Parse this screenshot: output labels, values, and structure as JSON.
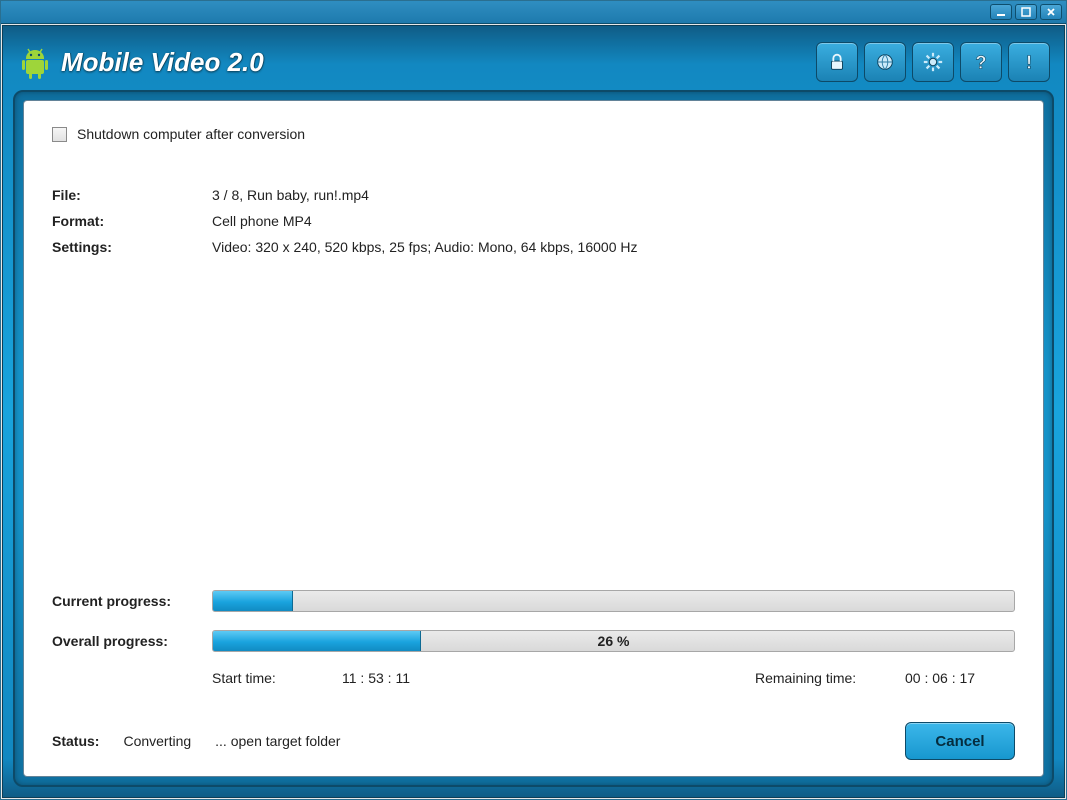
{
  "window_controls": {
    "minimize": "minimize",
    "maximize": "maximize",
    "close": "close"
  },
  "brand": {
    "title": "Mobile Video 2.0"
  },
  "header_icons": {
    "lock": "lock-icon",
    "globe": "globe-icon",
    "settings": "gear-icon",
    "help": "question-icon",
    "about": "exclaim-icon"
  },
  "options": {
    "shutdown_label": "Shutdown computer after conversion",
    "shutdown_checked": false
  },
  "info": {
    "file_label": "File:",
    "file_value": "3 / 8, Run baby, run!.mp4",
    "format_label": "Format:",
    "format_value": "Cell phone MP4",
    "settings_label": "Settings:",
    "settings_value": "Video: 320 x 240, 520 kbps, 25 fps; Audio: Mono, 64 kbps, 16000 Hz"
  },
  "progress": {
    "current_label": "Current progress:",
    "current_percent": 10,
    "overall_label": "Overall progress:",
    "overall_percent": 26,
    "overall_text": "26 %",
    "start_label": "Start time:",
    "start_value": "11 : 53 : 11",
    "remaining_label": "Remaining time:",
    "remaining_value": "00 : 06 : 17"
  },
  "status": {
    "label": "Status:",
    "value": "Converting",
    "open_folder": "... open target folder"
  },
  "buttons": {
    "cancel": "Cancel"
  }
}
